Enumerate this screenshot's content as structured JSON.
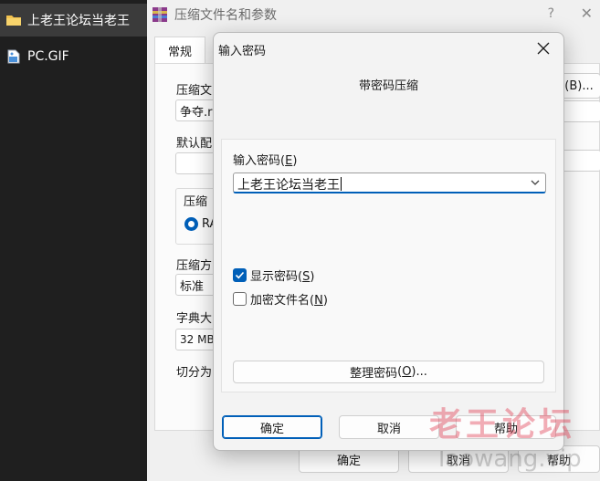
{
  "explorer": {
    "items": [
      {
        "icon": "folder-icon",
        "label": "上老王论坛当老王",
        "selected": true
      },
      {
        "icon": "gif-file-icon",
        "label": "PC.GIF",
        "selected": false
      }
    ]
  },
  "background_dialog": {
    "title": "压缩文件名和参数",
    "help_glyph": "?",
    "close_glyph": "✕",
    "tab_general": "常规",
    "archive_name_label": "压缩文",
    "archive_name_value": "争夺.r",
    "browse_label": "(B)...",
    "default_profile_label": "默认配",
    "format_group_label": "压缩",
    "format_rar_label": "RA",
    "method_label": "压缩方",
    "method_value": "标准",
    "dict_label": "字典大",
    "dict_value": "32 MB",
    "split_label": "切分为",
    "ok": "确定",
    "cancel": "取消",
    "help": "帮助"
  },
  "password_dialog": {
    "title": "输入密码",
    "heading": "带密码压缩",
    "password_label": "输入密码",
    "password_hotkey": "E",
    "password_value": "上老王论坛当老王",
    "show_password_label": "显示密码",
    "show_password_hotkey": "S",
    "show_password_checked": true,
    "encrypt_names_label": "加密文件名",
    "encrypt_names_hotkey": "N",
    "encrypt_names_checked": false,
    "organize_label": "整理密码",
    "organize_hotkey": "O",
    "organize_suffix": "...",
    "ok": "确定",
    "cancel": "取消",
    "help": "帮助"
  },
  "watermark": {
    "cn": "老王论坛",
    "en": "laowang.vip"
  },
  "colors": {
    "accent": "#005fb8",
    "folder": "#f2c14e"
  }
}
